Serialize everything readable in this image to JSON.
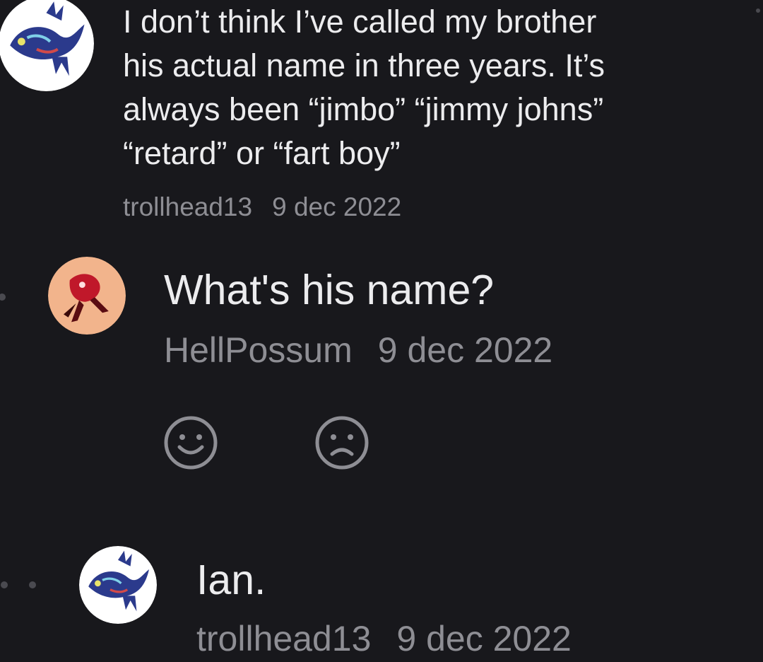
{
  "comments": [
    {
      "avatar": "kyogre-avatar",
      "lines": [
        "I don’t think I’ve called my brother",
        "his actual name in three years. It’s",
        "always been “jimbo” “jimmy johns”",
        "“retard” or “fart boy”"
      ],
      "username": "trollhead13",
      "date": "9 dec 2022"
    },
    {
      "avatar": "possum-avatar",
      "text": "What's his name?",
      "username": "HellPossum",
      "date": "9 dec 2022",
      "reactions": {
        "like_icon": "smile-face-icon",
        "dislike_icon": "frown-face-icon"
      }
    },
    {
      "avatar": "kyogre-avatar",
      "text": "Ian.",
      "username": "trollhead13",
      "date": "9 dec 2022"
    }
  ],
  "colors": {
    "background": "#18181c",
    "text": "#ececee",
    "meta": "#8e8e94",
    "icon": "#8e8e94"
  }
}
